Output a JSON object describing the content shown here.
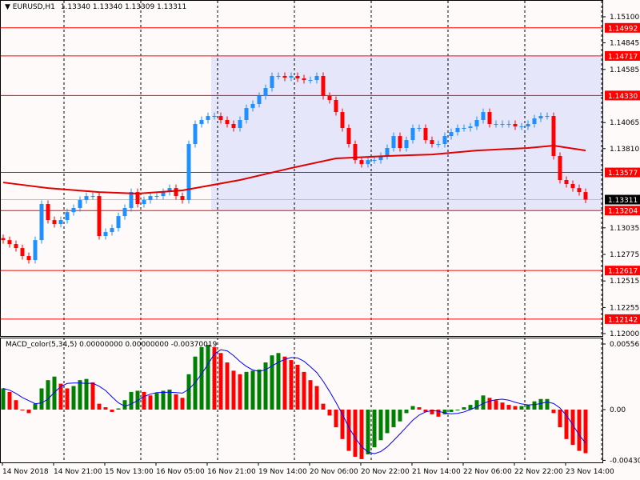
{
  "header": {
    "arrow_icon": "triangle-down-icon",
    "symbol": "EURUSD,H1",
    "values": "1.13340 1.13340 1.13309 1.13311"
  },
  "indicator": {
    "label": "MACD_color(5,34,5) 0.00000000 0.00000000 -0.00370019"
  },
  "colors": {
    "bull": "#1e90ff",
    "bear": "#ff0000",
    "level": "#ff0000",
    "ma": "#e00000",
    "zone": "#e6e6fa",
    "hist_up": "#008000",
    "hist_down": "#ff0000",
    "signal": "#0000ff",
    "current": "#000000"
  },
  "chart_data": [
    {
      "type": "candlestick",
      "title": "EURUSD,H1",
      "ylim": [
        1.12,
        1.151
      ],
      "price_ticks": [
        "1.15100",
        "1.14845",
        "1.14585",
        "1.14065",
        "1.13810",
        "1.13035",
        "1.12775",
        "1.12515",
        "1.12255",
        "1.12000"
      ],
      "time_ticks": [
        "14 Nov 2018",
        "14 Nov 21:00",
        "15 Nov 13:00",
        "16 Nov 05:00",
        "16 Nov 21:00",
        "19 Nov 14:00",
        "20 Nov 06:00",
        "20 Nov 22:00",
        "21 Nov 14:00",
        "22 Nov 06:00",
        "22 Nov 22:00",
        "23 Nov 14:00"
      ],
      "close": [
        1.12915,
        1.12876,
        1.12837,
        1.12759,
        1.1272,
        1.12915,
        1.13268,
        1.13111,
        1.13072,
        1.13111,
        1.13189,
        1.13229,
        1.13307,
        1.13346,
        1.13346,
        1.12955,
        1.12994,
        1.13033,
        1.1315,
        1.13229,
        1.13385,
        1.13268,
        1.13307,
        1.13346,
        1.13346,
        1.13385,
        1.13424,
        1.13346,
        1.13307,
        1.13855,
        1.14051,
        1.1409,
        1.14129,
        1.14129,
        1.1409,
        1.14051,
        1.14012,
        1.1409,
        1.14207,
        1.14247,
        1.14325,
        1.14403,
        1.14521,
        1.14521,
        1.14505,
        1.14521,
        1.14497,
        1.14481,
        1.14481,
        1.14521,
        1.14325,
        1.14286,
        1.14168,
        1.14012,
        1.13855,
        1.13698,
        1.13659,
        1.13698,
        1.13698,
        1.13738,
        1.13816,
        1.13933,
        1.13816,
        1.13894,
        1.14012,
        1.14012,
        1.13894,
        1.13855,
        1.13855,
        1.13933,
        1.13972,
        1.14012,
        1.14012,
        1.14027,
        1.1409,
        1.14168,
        1.14051,
        1.14051,
        1.14051,
        1.14051,
        1.14027,
        1.14027,
        1.14051,
        1.14106,
        1.14129,
        1.14129,
        1.13738,
        1.13503,
        1.13464,
        1.13424,
        1.13385,
        1.13311
      ],
      "moving_average": [
        [
          0,
          1.13479
        ],
        [
          7,
          1.13424
        ],
        [
          15,
          1.13385
        ],
        [
          21,
          1.1337
        ],
        [
          28,
          1.13401
        ],
        [
          37,
          1.13503
        ],
        [
          45,
          1.1362
        ],
        [
          52,
          1.13714
        ],
        [
          60,
          1.13738
        ],
        [
          67,
          1.13753
        ],
        [
          74,
          1.13792
        ],
        [
          82,
          1.13816
        ],
        [
          86,
          1.1384
        ],
        [
          91,
          1.13792
        ]
      ],
      "levels": [
        {
          "price": 1.14992,
          "label": "1.14992"
        },
        {
          "price": 1.14717,
          "label": "1.14717"
        },
        {
          "price": 1.1433,
          "label": "1.14330"
        },
        {
          "price": 1.13577,
          "label": "1.13577"
        },
        {
          "price": 1.13204,
          "label": "1.13204"
        },
        {
          "price": 1.12617,
          "label": "1.12617"
        },
        {
          "price": 1.12142,
          "label": "1.12142"
        }
      ],
      "zone": {
        "from_bar": 33,
        "to_price": 1.14717,
        "from_price": 1.13204
      },
      "current_price": {
        "price": 1.13311,
        "label": "1.13311"
      }
    },
    {
      "type": "bar",
      "title": "MACD_color(5,34,5)",
      "ylim": [
        -0.0045,
        0.0057
      ],
      "ticks": [
        "0.005565",
        "0.00",
        "-0.004307"
      ],
      "tick_values": [
        0.005565,
        0.0,
        -0.004307
      ],
      "histogram_e3": [
        1.8,
        1.5,
        0.8,
        0.0,
        -0.3,
        0.5,
        1.8,
        2.5,
        2.8,
        2.2,
        1.8,
        2.0,
        2.5,
        2.6,
        2.3,
        0.5,
        0.2,
        -0.2,
        0.1,
        0.8,
        1.5,
        1.6,
        1.5,
        1.2,
        1.4,
        1.6,
        1.7,
        1.3,
        1.0,
        3.0,
        4.5,
        5.3,
        5.5,
        5.3,
        4.8,
        4.0,
        3.3,
        3.0,
        3.2,
        3.3,
        3.4,
        4.0,
        4.6,
        4.8,
        4.5,
        4.2,
        3.8,
        3.2,
        2.5,
        2.0,
        0.5,
        -0.5,
        -1.5,
        -2.5,
        -3.5,
        -4.0,
        -4.2,
        -3.8,
        -3.2,
        -2.6,
        -2.0,
        -1.5,
        -1.0,
        -0.3,
        0.3,
        0.2,
        -0.2,
        -0.4,
        -0.6,
        -0.4,
        -0.2,
        0.0,
        0.2,
        0.4,
        0.8,
        1.2,
        1.0,
        0.8,
        0.6,
        0.4,
        0.3,
        0.3,
        0.4,
        0.7,
        0.9,
        0.9,
        -0.3,
        -1.5,
        -2.5,
        -3.0,
        -3.5,
        -3.7
      ]
    }
  ]
}
